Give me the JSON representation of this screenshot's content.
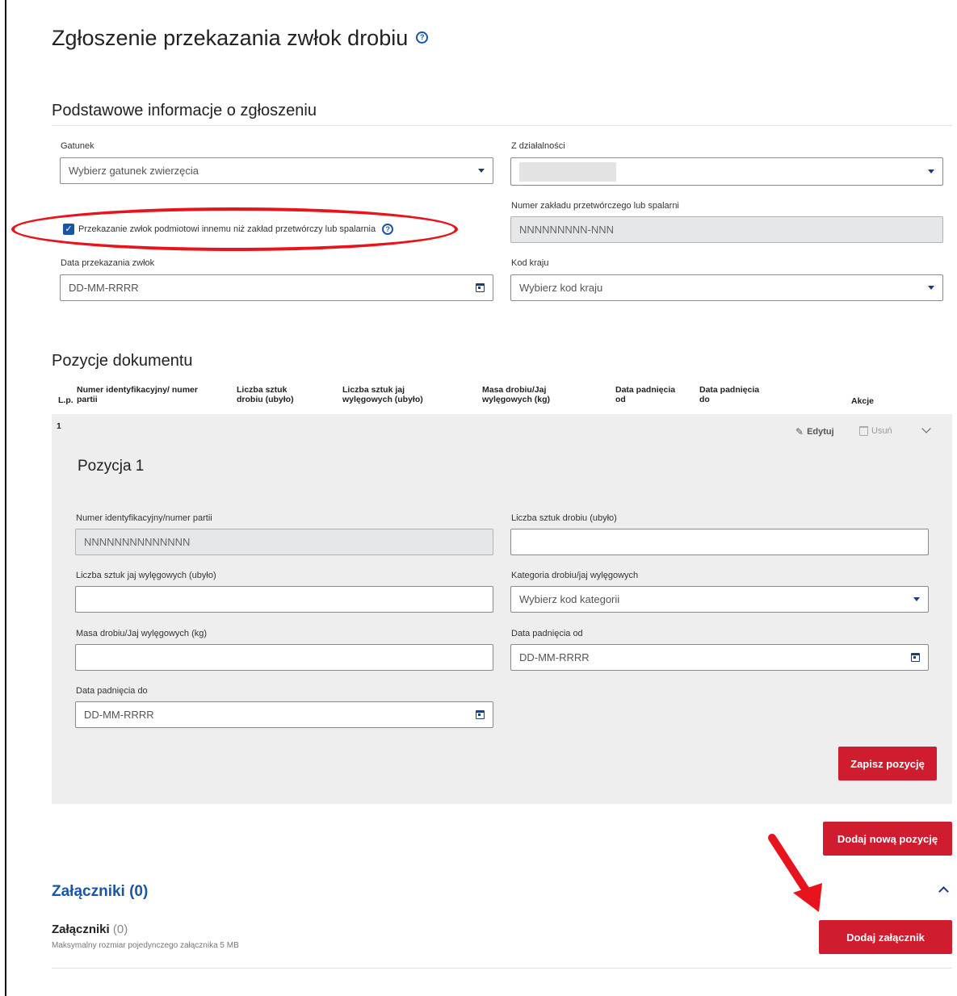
{
  "page": {
    "title": "Zgłoszenie przekazania zwłok drobiu"
  },
  "basic": {
    "section_title": "Podstawowe informacje o zgłoszeniu",
    "species_label": "Gatunek",
    "species_placeholder": "Wybierz gatunek zwierzęcia",
    "activity_label": "Z działalności",
    "plant_label": "Numer zakładu przetwórczego lub spalarni",
    "plant_value": "NNNNNNNNN-NNN",
    "checkbox_label": "Przekazanie zwłok podmiotowi innemu niż zakład przetwórczy lub spalarnia",
    "checkbox_checked": true,
    "date_label": "Data przekazania zwłok",
    "date_placeholder": "DD-MM-RRRR",
    "country_label": "Kod kraju",
    "country_placeholder": "Wybierz kod kraju"
  },
  "positions": {
    "section_title": "Pozycje dokumentu",
    "columns": [
      "L.p.",
      "Numer identyfikacyjny/ numer partii",
      "Liczba sztuk drobiu (ubyło)",
      "Liczba sztuk jaj wylęgowych (ubyło)",
      "Masa drobiu/Jaj wylęgowych (kg)",
      "Data padnięcia od",
      "Data padnięcia do",
      "Akcje"
    ],
    "row": {
      "number": "1",
      "edit_label": "Edytuj",
      "delete_label": "Usuń"
    },
    "form": {
      "title": "Pozycja 1",
      "id_label": "Numer identyfikacyjny/numer partii",
      "id_value": "NNNNNNNNNNNNNN",
      "poultry_count_label": "Liczba sztuk drobiu (ubyło)",
      "eggs_count_label": "Liczba sztuk jaj wylęgowych (ubyło)",
      "category_label": "Kategoria drobiu/jaj wylęgowych",
      "category_placeholder": "Wybierz kod kategorii",
      "mass_label": "Masa drobiu/Jaj wylęgowych (kg)",
      "date_from_label": "Data padnięcia od",
      "date_from_placeholder": "DD-MM-RRRR",
      "date_to_label": "Data padnięcia do",
      "date_to_placeholder": "DD-MM-RRRR",
      "save_button": "Zapisz pozycję"
    },
    "add_button": "Dodaj nową pozycję"
  },
  "attachments": {
    "section_title": "Załączniki (0)",
    "label": "Załączniki",
    "count": "(0)",
    "hint": "Maksymalny rozmiar pojedynczego załącznika 5 MB",
    "add_button": "Dodaj załącznik"
  },
  "colors": {
    "accent_blue": "#1a56a8",
    "button_red": "#d01c2f",
    "annotation_red": "#e8141d"
  }
}
